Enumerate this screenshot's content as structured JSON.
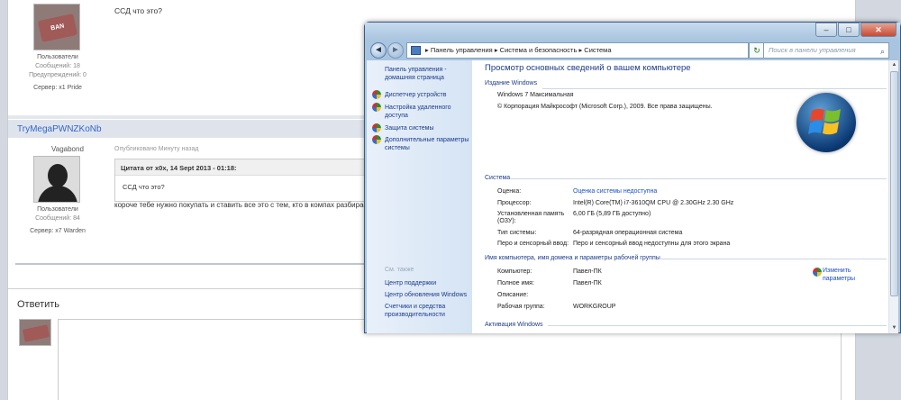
{
  "forum": {
    "post1": {
      "avatar_text": "BAN",
      "role": "Пользователи",
      "messages": "Сообщений: 18",
      "warnings": "Предупреждений: 0",
      "server": "Сервер: x1 Pride",
      "message": "ССД что это?"
    },
    "post2": {
      "header_user": "TryMegaPWNZKoNb",
      "username": "Vagabond",
      "published": "Опубликовано Минуту назад",
      "quote_header": "Цитата от x0x, 14 Sept 2013 - 01:18:",
      "quote_body": "ССД что это?",
      "reply": "короче тебе нужно покупать и ставить все это с тем, кто в компах разбирае",
      "role": "Пользователи",
      "messages": "Сообщений: 84",
      "server": "Сервер: x7 Warden"
    },
    "reply_title": "Ответить"
  },
  "window": {
    "buttons": {
      "minimize": "–",
      "maximize": "□",
      "close": "✕"
    },
    "nav": {
      "back": "◄",
      "forward": "►",
      "down": "▾",
      "refresh": "↻"
    },
    "address": "▸ Панель управления ▸ Система и безопасность ▸ Система",
    "search_placeholder": "Поиск в панели управления",
    "search_icon": "⌕",
    "left": {
      "home": "Панель управления -",
      "home2": "домашняя страница",
      "links": [
        "Диспетчер устройств",
        "Настройка удаленного",
        "доступа",
        "Защита системы",
        "Дополнительные параметры",
        "системы"
      ],
      "see_also": "См. также",
      "also": [
        "Центр поддержки",
        "Центр обновления Windows",
        "Счетчики и средства",
        "производительности"
      ]
    },
    "main": {
      "title": "Просмотр основных сведений о вашем компьютере",
      "edition_header": "Издание Windows",
      "edition": "Windows 7 Максимальная",
      "copyright": "© Корпорация Майкрософт (Microsoft Corp.), 2009. Все права защищены.",
      "system_header": "Система",
      "rows": [
        {
          "label": "Оценка:",
          "value": "Оценка системы недоступна"
        },
        {
          "label": "Процессор:",
          "value": "Intel(R) Core(TM) i7-3610QM CPU @ 2.30GHz   2.30 GHz"
        },
        {
          "label": "Установленная память",
          "label2": "(ОЗУ):",
          "value": "6,00 ГБ (5,89 ГБ доступно)"
        },
        {
          "label": "Тип системы:",
          "value": "64-разрядная операционная система"
        },
        {
          "label": "Перо и сенсорный ввод:",
          "value": "Перо и сенсорный ввод недоступны для этого экрана"
        }
      ],
      "name_header": "Имя компьютера, имя домена и параметры рабочей группы",
      "name_rows": [
        {
          "label": "Компьютер:",
          "value": "Павел-ПК"
        },
        {
          "label": "Полное имя:",
          "value": "Павел-ПК"
        },
        {
          "label": "Описание:",
          "value": ""
        },
        {
          "label": "Рабочая группа:",
          "value": "WORKGROUP"
        }
      ],
      "change1": "Изменить",
      "change2": "параметры",
      "activation_header": "Активация Windows"
    }
  }
}
